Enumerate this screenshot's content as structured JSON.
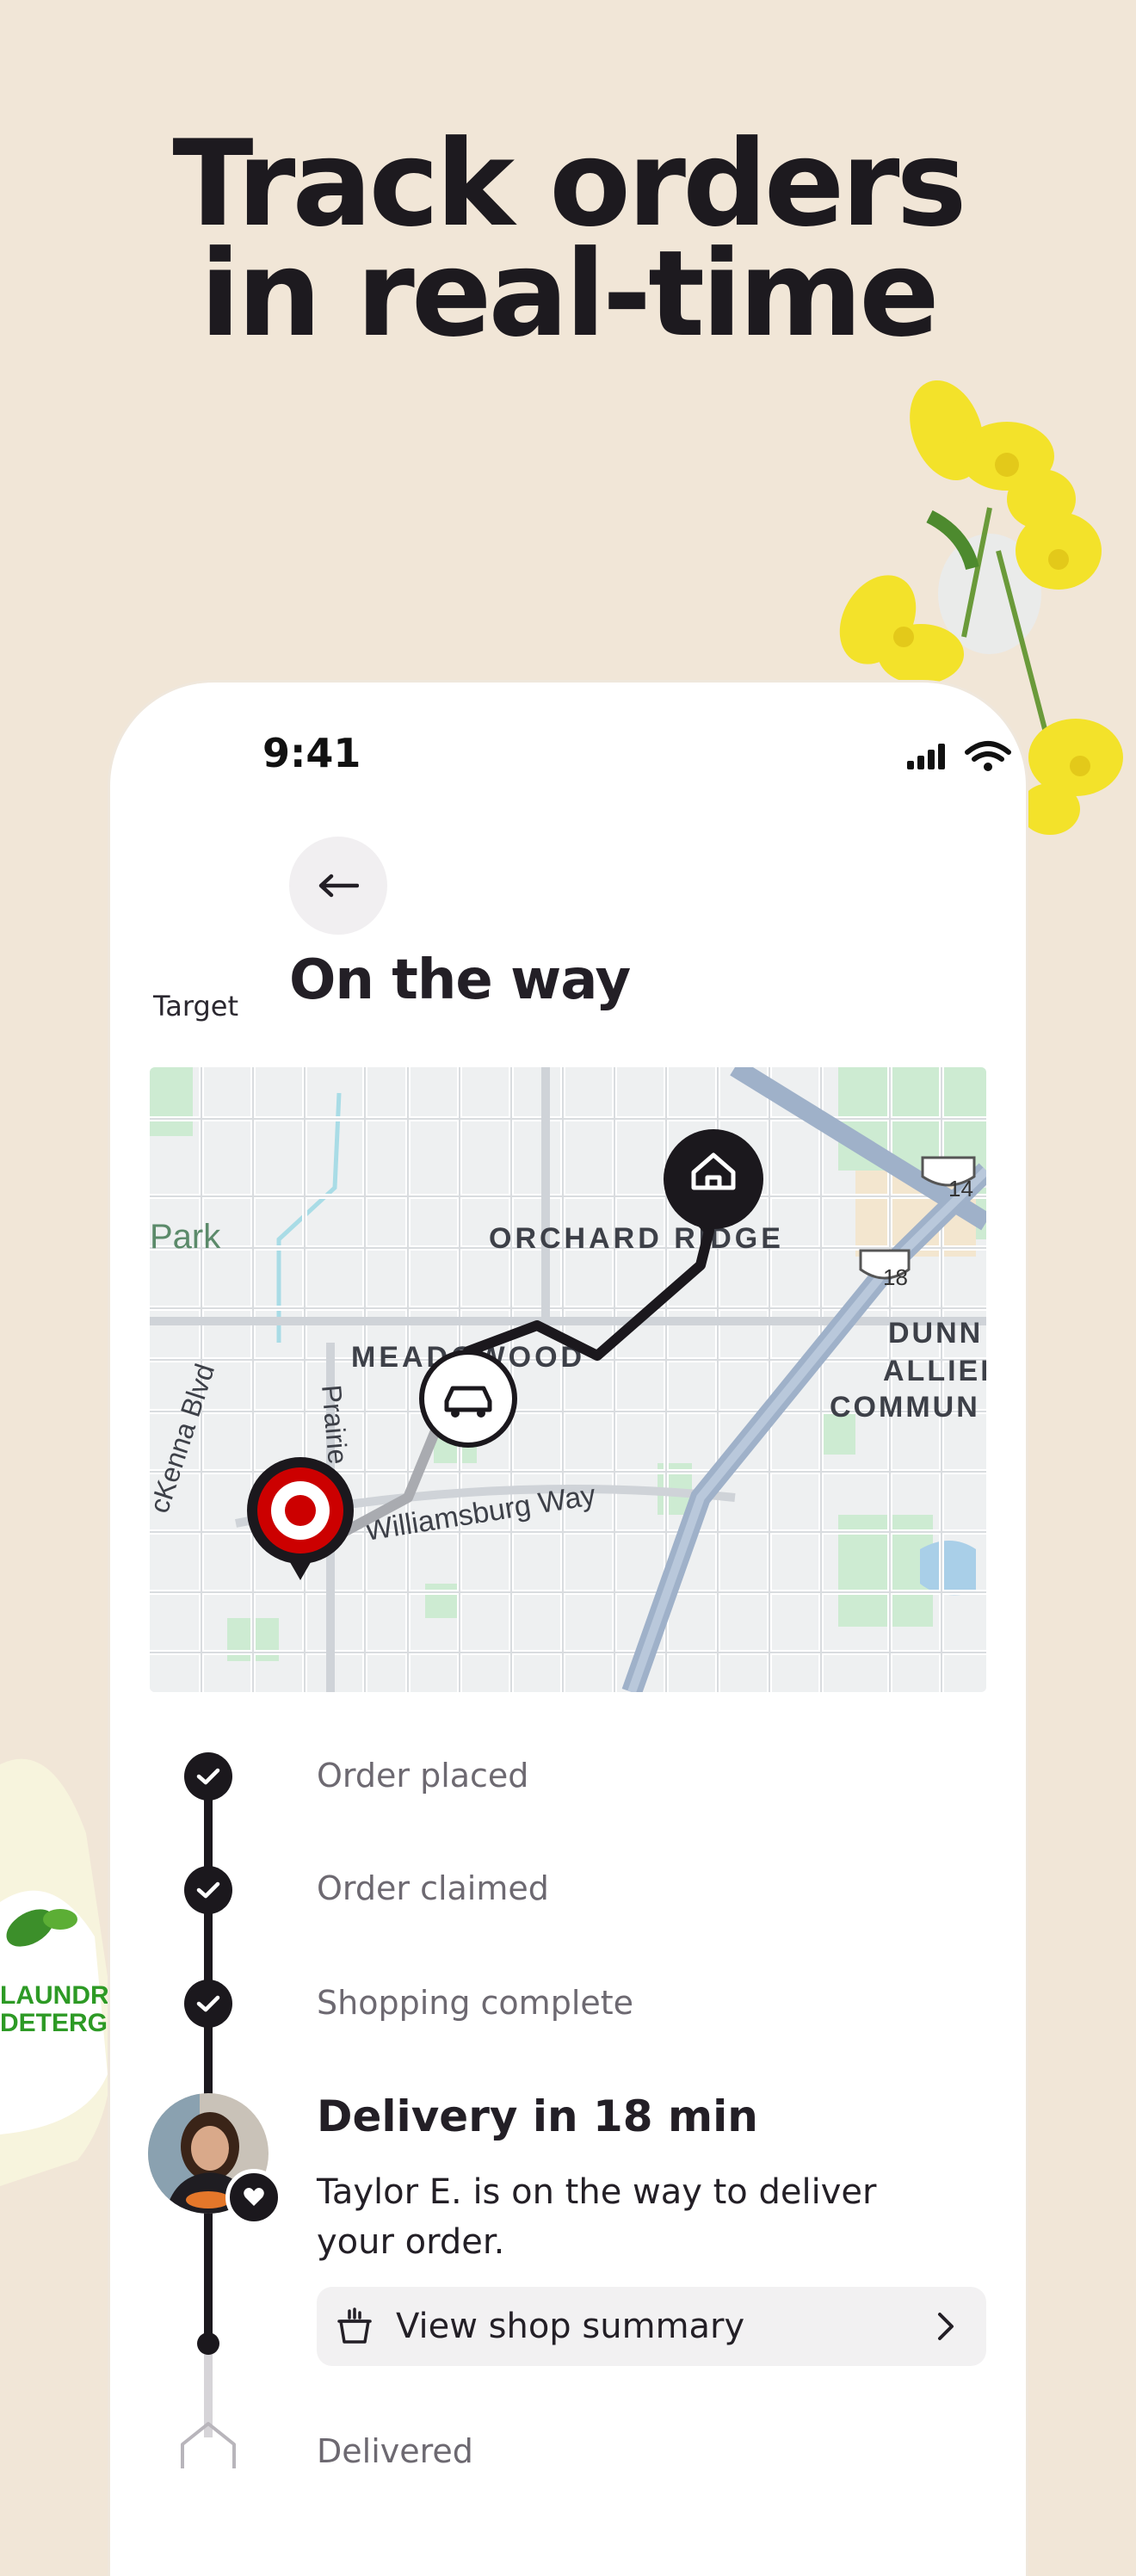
{
  "headline": {
    "line1": "Track orders",
    "line2": "in real-time"
  },
  "status_bar": {
    "time": "9:41"
  },
  "header": {
    "store": "Target",
    "title": "On the way"
  },
  "map": {
    "labels": {
      "park": "Park",
      "orchard_ridge": "ORCHARD RIDGE",
      "meadowood": "MEADOWOOD",
      "dunn_1": "DUNN",
      "dunn_2": "ALLIEI",
      "dunn_3": "COMMUN",
      "mckenna": "cKenna Blvd",
      "prairie": "Prairie",
      "williamsburg": "Williamsburg Way",
      "route_14": "14",
      "route_18": "18"
    }
  },
  "timeline": {
    "steps": [
      {
        "label": "Order placed"
      },
      {
        "label": "Order claimed"
      },
      {
        "label": "Shopping complete"
      }
    ],
    "current": {
      "title": "Delivery in 18 min",
      "subtitle": "Taylor E. is on the way to deliver your order."
    },
    "summary_button": "View shop summary",
    "final_step": "Delivered"
  },
  "colors": {
    "background": "#f1e6d7",
    "accent_target": "#cc0000",
    "dark": "#1b181d"
  }
}
